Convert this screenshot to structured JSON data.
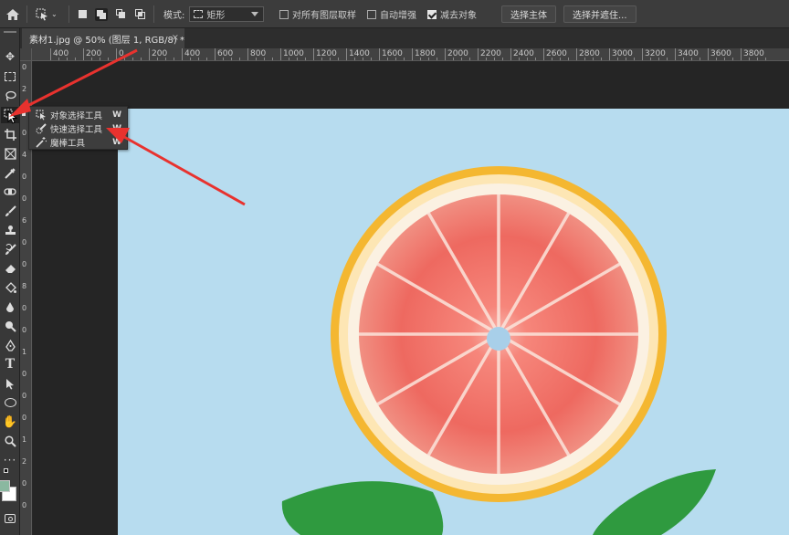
{
  "options_bar": {
    "home_icon": "home-icon",
    "mode_label": "模式:",
    "mode_value": "矩形",
    "sample_all_layers": "对所有图层取样",
    "sample_all_layers_checked": false,
    "auto_enhance": "自动增强",
    "auto_enhance_checked": false,
    "subtract_object": "减去对象",
    "subtract_object_checked": true,
    "select_subject": "选择主体",
    "select_and_mask": "选择并遮住..."
  },
  "document_tab": {
    "title": "素材1.jpg @ 50% (图层 1, RGB/8) *",
    "close": "×"
  },
  "ruler": {
    "h_labels": [
      "400",
      "200",
      "0",
      "200",
      "400",
      "600",
      "800",
      "1000",
      "1200",
      "1400",
      "1600",
      "1800",
      "2000",
      "2200",
      "2400",
      "2600",
      "2800",
      "3000",
      "3200",
      "3400",
      "3600",
      "3800"
    ],
    "v_labels": [
      "0",
      "2",
      "0",
      "0",
      "4",
      "0",
      "0",
      "6",
      "0",
      "0",
      "8",
      "0",
      "0",
      "1",
      "0",
      "0",
      "0",
      "1",
      "2",
      "0",
      "0"
    ]
  },
  "flyout": {
    "items": [
      {
        "label": "对象选择工具",
        "shortcut": "W",
        "icon": "object-selection-icon",
        "selected": true
      },
      {
        "label": "快速选择工具",
        "shortcut": "W",
        "icon": "quick-selection-icon",
        "selected": false
      },
      {
        "label": "魔棒工具",
        "shortcut": "W",
        "icon": "magic-wand-icon",
        "selected": false
      }
    ]
  },
  "colors": {
    "photo_background": "#b7dcef",
    "grapefruit_flesh": "#f0726a",
    "rind": "#f7c437",
    "leaf": "#2f9a3f",
    "annotation_arrow": "#e8322e",
    "foreground_swatch": "#8ab8a0",
    "background_swatch": "#ffffff"
  }
}
